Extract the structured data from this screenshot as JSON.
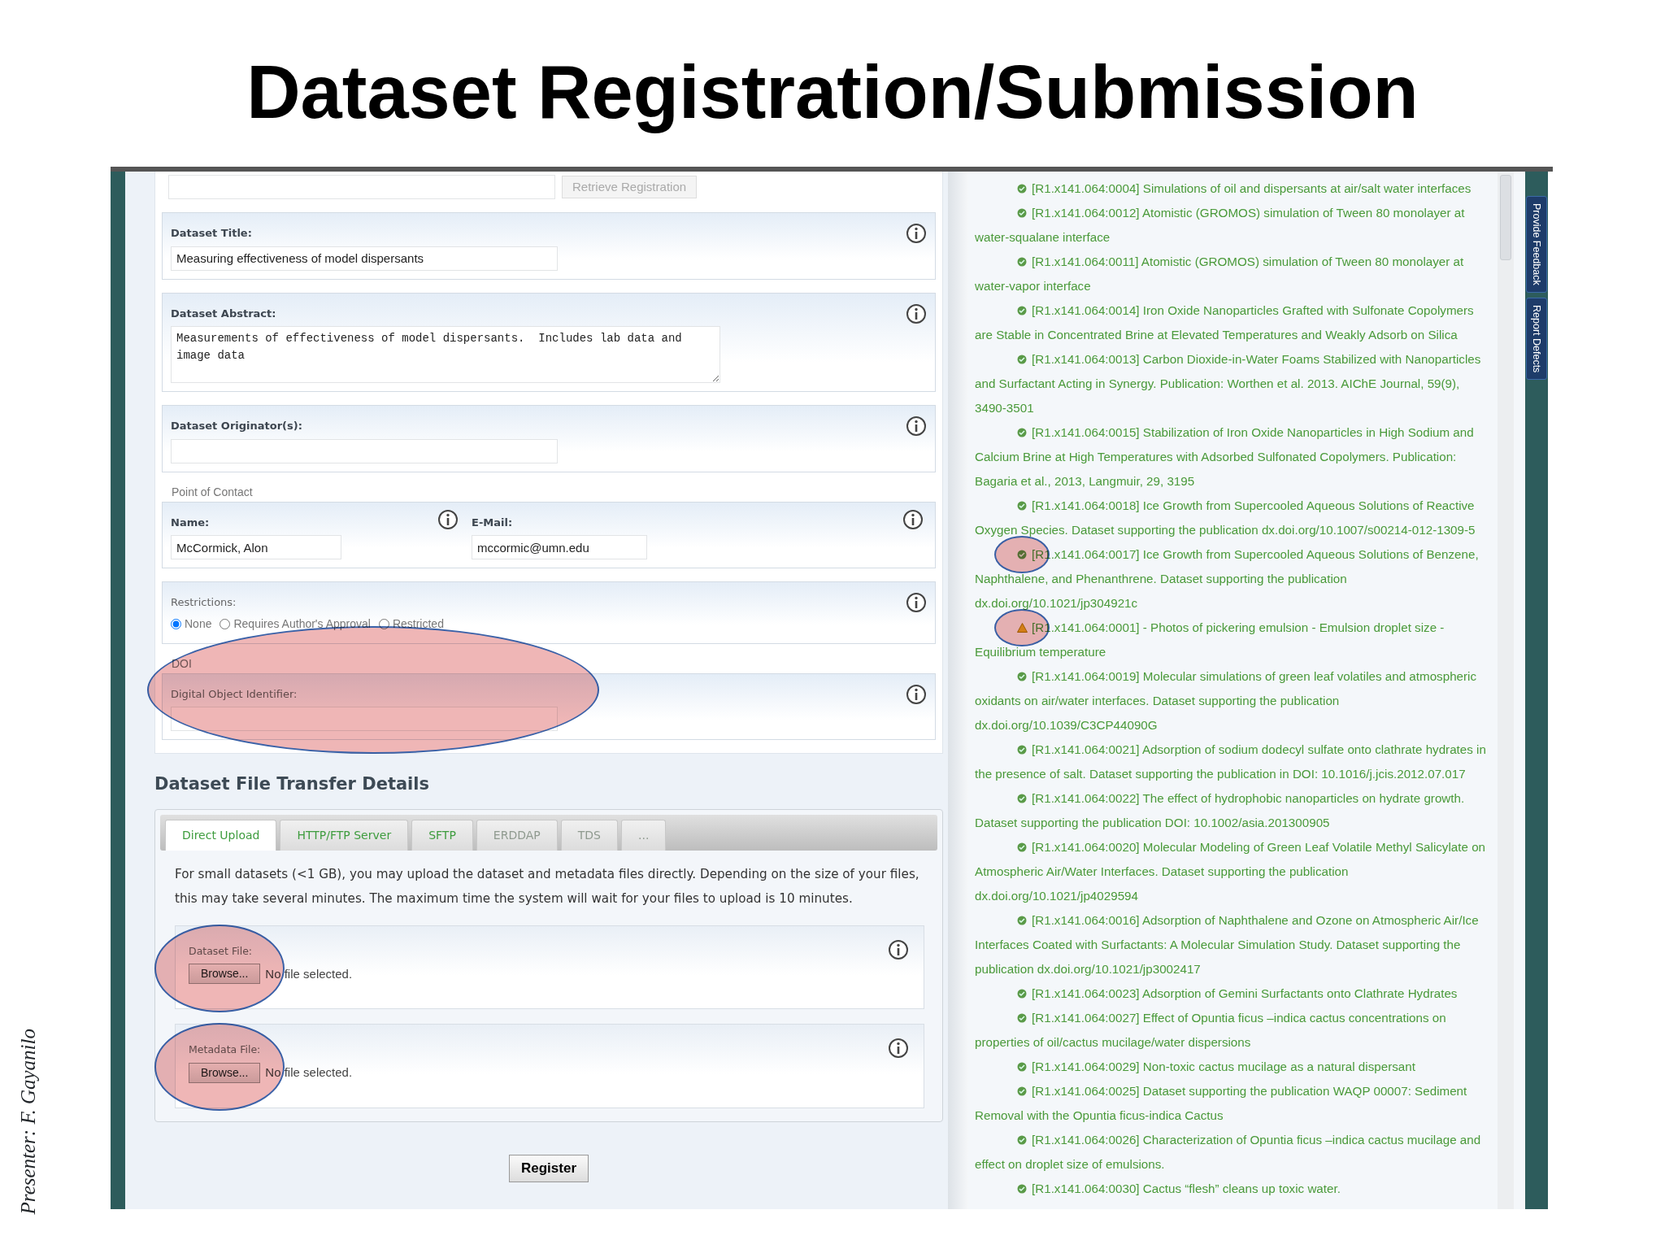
{
  "slide_title": "Dataset Registration/Submission",
  "presenter": "Presenter: F. Gayanilo",
  "registration": {
    "retrieve_button": {
      "label": "Retrieve Registration",
      "disabled": true
    },
    "fields": [
      {
        "kind": "text",
        "label": "Dataset Title:",
        "value": "Measuring effectiveness of model dispersants"
      },
      {
        "kind": "textarea",
        "label": "Dataset Abstract:",
        "value": "Measurements of effectiveness of model dispersants.  Includes lab data and image data"
      },
      {
        "kind": "text",
        "label": "Dataset Originator(s):"
      }
    ],
    "contact": {
      "legend": "Point of Contact",
      "name_label": "Name:",
      "name": "McCormick, Alon",
      "email_label": "E-Mail:",
      "email": "mccormic@umn.edu"
    },
    "restrictions": {
      "label": "Restrictions:",
      "options": [
        {
          "label": "None",
          "selected": true
        },
        {
          "label": "Requires Author's Approval",
          "selected": false
        },
        {
          "label": "Restricted",
          "selected": false
        }
      ]
    },
    "doi": {
      "legend": "DOI",
      "label": "Digital Object Identifier:",
      "circled": true
    }
  },
  "transfer": {
    "heading": "Dataset File Transfer Details",
    "tabs": [
      {
        "label": "Direct Upload",
        "selected": true,
        "disabled": false
      },
      {
        "label": "HTTP/FTP Server",
        "selected": false,
        "disabled": false
      },
      {
        "label": "SFTP",
        "selected": false,
        "disabled": false
      },
      {
        "label": "ERDDAP",
        "selected": false,
        "disabled": true
      },
      {
        "label": "TDS",
        "selected": false,
        "disabled": true
      },
      {
        "label": "...",
        "selected": false,
        "disabled": true
      }
    ],
    "description": "For small datasets (<1 GB), you may upload the dataset and metadata files directly. Depending on the size of your files, this may take several minutes. The maximum time the system will wait for your files to upload is 10 minutes.",
    "files": [
      {
        "label": "Dataset File:",
        "button": "Browse...",
        "status": "No file selected.",
        "circled": true
      },
      {
        "label": "Metadata File:",
        "button": "Browse...",
        "status": "No file selected.",
        "circled": true
      }
    ]
  },
  "register_button": "Register",
  "datasets": [
    {
      "kind": "ok",
      "circled": false,
      "text": "[R1.x141.064:0004] Simulations of oil and dispersants at air/salt water interfaces"
    },
    {
      "kind": "ok",
      "circled": false,
      "text": "[R1.x141.064:0012] Atomistic (GROMOS) simulation of Tween 80 monolayer at water-squalane interface"
    },
    {
      "kind": "ok",
      "circled": false,
      "text": "[R1.x141.064:0011] Atomistic (GROMOS) simulation of Tween 80 monolayer at water-vapor interface"
    },
    {
      "kind": "ok",
      "circled": false,
      "text": "[R1.x141.064:0014] Iron Oxide Nanoparticles Grafted with Sulfonate Copolymers are Stable in Concentrated Brine at Elevated Temperatures and Weakly Adsorb on Silica"
    },
    {
      "kind": "ok",
      "circled": false,
      "text": "[R1.x141.064:0013] Carbon Dioxide-in-Water Foams Stabilized with Nanoparticles and Surfactant Acting in Synergy. Publication: Worthen et al. 2013. AIChE Journal, 59(9), 3490-3501"
    },
    {
      "kind": "ok",
      "circled": false,
      "text": "[R1.x141.064:0015] Stabilization of Iron Oxide Nanoparticles in High Sodium and Calcium Brine at High Temperatures with Adsorbed Sulfonated Copolymers. Publication: Bagaria et al., 2013, Langmuir, 29, 3195"
    },
    {
      "kind": "ok",
      "circled": false,
      "text": "[R1.x141.064:0018] Ice Growth from Supercooled Aqueous Solutions of Reactive Oxygen Species. Dataset supporting the publication dx.doi.org/10.1007/s00214-012-1309-5"
    },
    {
      "kind": "ok",
      "circled": true,
      "text": "[R1.x141.064:0017] Ice Growth from Supercooled Aqueous Solutions of Benzene, Naphthalene, and Phenanthrene. Dataset supporting the publication dx.doi.org/10.1021/jp304921c"
    },
    {
      "kind": "warning",
      "circled": true,
      "text": "[R1.x141.064:0001] - Photos of pickering emulsion - Emulsion droplet size - Equilibrium temperature"
    },
    {
      "kind": "ok",
      "circled": false,
      "text": "[R1.x141.064:0019] Molecular simulations of green leaf volatiles and atmospheric oxidants on air/water interfaces. Dataset supporting the publication dx.doi.org/10.1039/C3CP44090G"
    },
    {
      "kind": "ok",
      "circled": false,
      "text": "[R1.x141.064:0021] Adsorption of sodium dodecyl sulfate onto clathrate hydrates in the presence of salt. Dataset supporting the publication in DOI: 10.1016/j.jcis.2012.07.017"
    },
    {
      "kind": "ok",
      "circled": false,
      "text": "[R1.x141.064:0022] The effect of hydrophobic nanoparticles on hydrate growth. Dataset supporting the publication DOI: 10.1002/asia.201300905"
    },
    {
      "kind": "ok",
      "circled": false,
      "text": "[R1.x141.064:0020] Molecular Modeling of Green Leaf Volatile Methyl Salicylate on Atmospheric Air/Water Interfaces. Dataset supporting the publication dx.doi.org/10.1021/jp4029594"
    },
    {
      "kind": "ok",
      "circled": false,
      "text": "[R1.x141.064:0016] Adsorption of Naphthalene and Ozone on Atmospheric Air/Ice Interfaces Coated with Surfactants: A Molecular Simulation Study. Dataset supporting the publication dx.doi.org/10.1021/jp3002417"
    },
    {
      "kind": "ok",
      "circled": false,
      "text": "[R1.x141.064:0023] Adsorption of Gemini Surfactants onto Clathrate Hydrates"
    },
    {
      "kind": "ok",
      "circled": false,
      "text": "[R1.x141.064:0027] Effect of Opuntia ficus –indica cactus concentrations on properties of oil/cactus mucilage/water dispersions"
    },
    {
      "kind": "ok",
      "circled": false,
      "text": "[R1.x141.064:0029] Non-toxic cactus mucilage as a natural dispersant"
    },
    {
      "kind": "ok",
      "circled": false,
      "text": "[R1.x141.064:0025] Dataset supporting the publication WAQP 00007: Sediment Removal with the Opuntia ficus-indica Cactus"
    },
    {
      "kind": "ok",
      "circled": false,
      "text": "[R1.x141.064:0026] Characterization of Opuntia ficus –indica cactus mucilage and effect on droplet size of emulsions."
    },
    {
      "kind": "ok",
      "circled": false,
      "text": "[R1.x141.064:0030] Cactus “flesh” cleans up toxic water."
    }
  ],
  "side_tabs": [
    "Provide Feedback",
    "Report Defects"
  ]
}
